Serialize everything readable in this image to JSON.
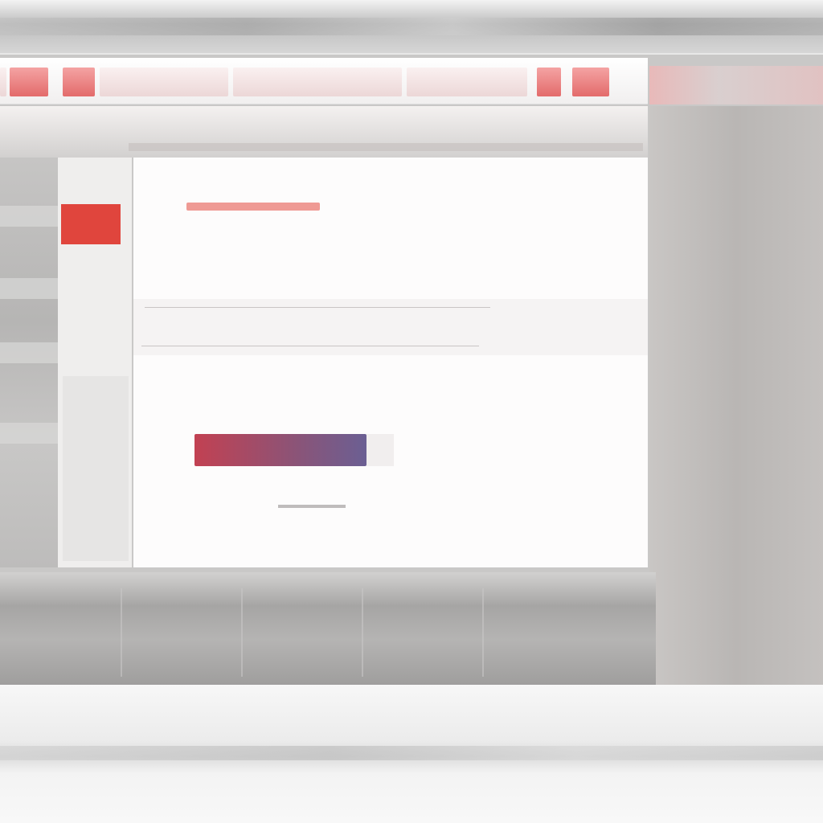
{
  "colors": {
    "accent": "#e0453d",
    "cta_gradient_start": "#c24152",
    "cta_gradient_end": "#6b5f93"
  },
  "sidebar": {
    "badge": "",
    "fav_label": "",
    "item_1": "",
    "item_2": "",
    "item_3": "",
    "bottom_label": ""
  },
  "main": {
    "brand_small": "",
    "brand_title": "",
    "description": "",
    "row_1": "",
    "row_2": "",
    "info_1": "",
    "info_2": "",
    "cta_label": ""
  }
}
